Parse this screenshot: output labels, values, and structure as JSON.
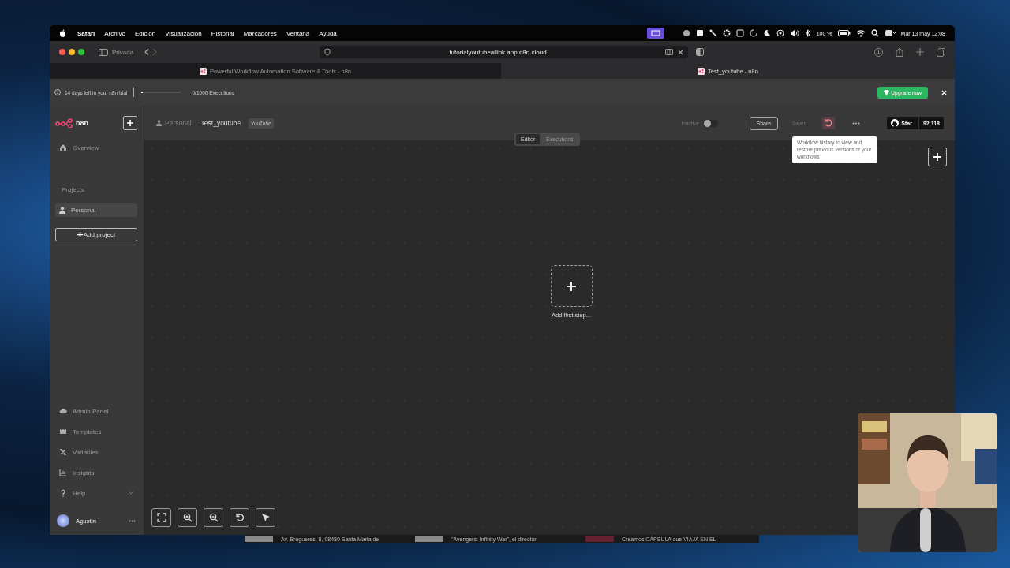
{
  "menu_bar": {
    "app_name": "Safari",
    "items": [
      "Archivo",
      "Edición",
      "Visualización",
      "Historial",
      "Marcadores",
      "Ventana",
      "Ayuda"
    ],
    "battery": "100 %",
    "clock": "Mar 13 may 12:08"
  },
  "browser": {
    "private_label": "Privada",
    "address": "tutorialyoutubeailink.app.n8n.cloud",
    "tabs": [
      {
        "title": "Powerful Workflow Automation Software & Tools - n8n",
        "selected": false
      },
      {
        "title": "Test_youtube - n8n",
        "selected": true
      }
    ]
  },
  "trial_banner": {
    "message": "14 days left in your n8n trial",
    "level": 0.03,
    "executions": "0/1000 Executions",
    "upgrade_button": "Upgrade now"
  },
  "sidebar": {
    "logo": "n8n",
    "items": [
      {
        "label": "Overview"
      }
    ],
    "projects_heading": "Projects",
    "projects": [
      {
        "label": "Personal",
        "selected": true
      }
    ],
    "add_project": "Add project",
    "bottom_items": [
      {
        "label": "Admin Panel"
      },
      {
        "label": "Templates"
      },
      {
        "label": "Variables"
      },
      {
        "label": "Insights"
      },
      {
        "label": "Help",
        "expandable": true
      }
    ],
    "user": {
      "name": "Agustin"
    }
  },
  "header": {
    "breadcrumbs": [
      "Personal",
      "Test_youtube"
    ],
    "tag": "YouTube",
    "active_label": "Inactive",
    "active": false,
    "share": "Share",
    "saved": "Saved",
    "star": "Star",
    "star_count": "92,118"
  },
  "view_tabs": [
    {
      "label": "Editor",
      "selected": true
    },
    {
      "label": "Executions",
      "selected": false
    }
  ],
  "tooltip": "Workflow history to view and restore previous versions of your workflows",
  "canvas": {
    "add_first_step": "Add first step..."
  },
  "background_tabs": [
    "Av. Brugueres, 8, 08480 Santa Maria de",
    "\"Avengers: Infinity War\", el director",
    "Creamos CÁPSULA que VIAJA EN EL"
  ]
}
